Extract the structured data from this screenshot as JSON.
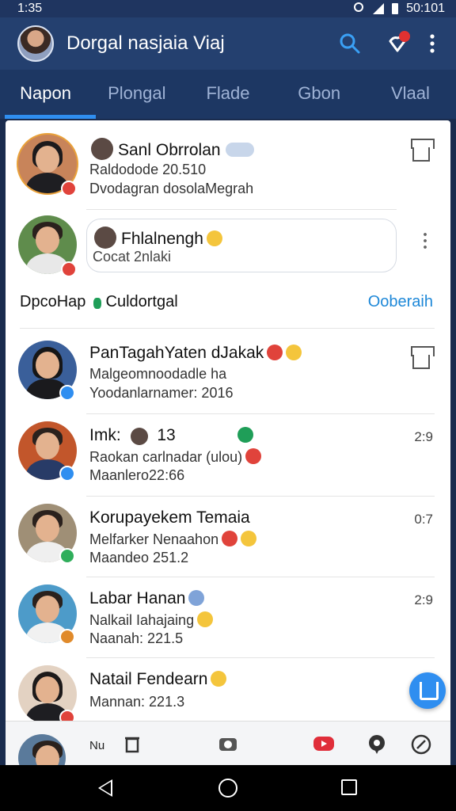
{
  "status": {
    "time": "1:35",
    "right_text": "50:101"
  },
  "appbar": {
    "title": "Dorgal nasjaia Viaj"
  },
  "tabs": [
    {
      "label": "Napon",
      "active": true
    },
    {
      "label": "Plongal",
      "active": false
    },
    {
      "label": "Flade",
      "active": false
    },
    {
      "label": "Gbon",
      "active": false
    },
    {
      "label": "Vlaal",
      "active": false
    }
  ],
  "story": {
    "name": "Sanl Obrrolan",
    "line1": "Raldodode 20.510",
    "line2": "Dvodagran dosolaMegrah"
  },
  "composer": {
    "name": "Fhlalnengh",
    "placeholder": "Cocat 2nlaki"
  },
  "section": {
    "title": "DpcoHap",
    "title_suffix": "Culdortgal",
    "link": "Ooberaih"
  },
  "chats": [
    {
      "name": "PanTagahYaten dJakak",
      "line1": "Malgeomnoodadle ha",
      "line2": "Yoodanlarnamer: 2016",
      "time": ""
    },
    {
      "name": "Imk:",
      "name_extra": "13",
      "line1": "Raokan carlnadar (ulou)",
      "line2": "Maanlero22:66",
      "time": "2:9"
    },
    {
      "name": "Korupayekem Temaia",
      "line1": "Melfarker Nenaahon",
      "line2": "Maandeo 251.2",
      "time": "0:7"
    },
    {
      "name": "Labar Hanan",
      "line1": "Nalkail Iahajaing",
      "line2": "Naanah: 221.5",
      "time": "2:9"
    },
    {
      "name": "Natail Fendearn",
      "line1": "Mannan: 221.3",
      "line2": "",
      "time": ""
    }
  ],
  "bottombar": {
    "label": "Nu"
  },
  "colors": {
    "accent": "#2f8ef0",
    "appbar": "#24406f",
    "tabs": "#1d3763",
    "link": "#1e88d8"
  }
}
